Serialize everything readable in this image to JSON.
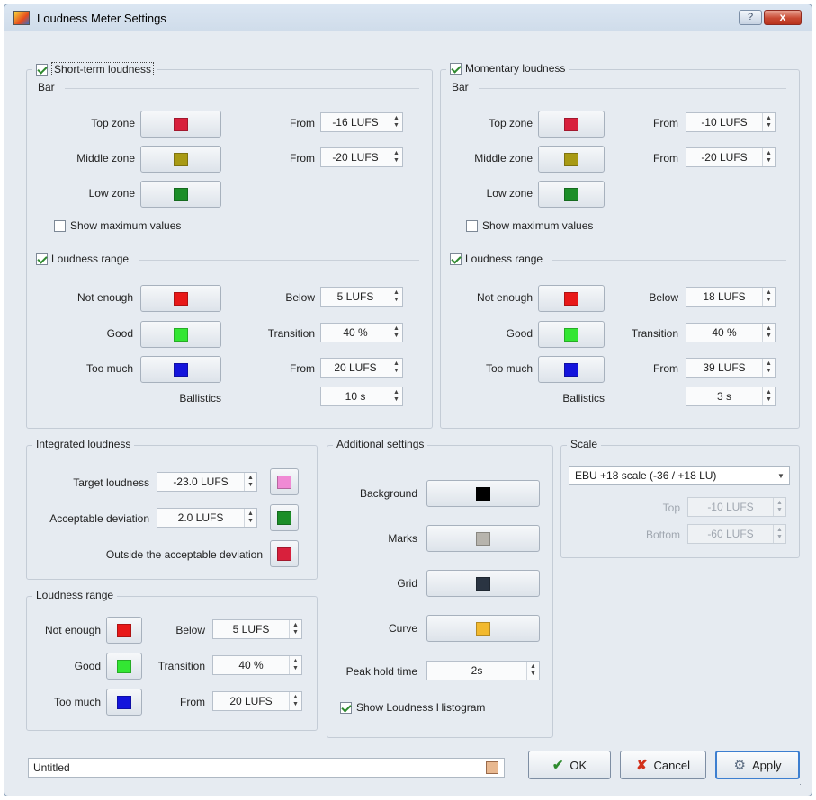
{
  "window": {
    "title": "Loudness Meter Settings",
    "help_label": "?",
    "close_label": "x"
  },
  "short_term": {
    "title": "Short-term loudness",
    "bar": {
      "label": "Bar",
      "top_zone": "Top zone",
      "middle_zone": "Middle zone",
      "low_zone": "Low zone",
      "from_label": "From",
      "top_from": "-16 LUFS",
      "middle_from": "-20 LUFS",
      "colors": {
        "top": "#d8203c",
        "middle": "#a89a14",
        "low": "#1c8e28"
      },
      "show_max": "Show maximum values"
    },
    "range": {
      "title": "Loudness range",
      "not_enough": "Not enough",
      "good": "Good",
      "too_much": "Too much",
      "below_label": "Below",
      "transition_label": "Transition",
      "from_label": "From",
      "below": "5 LUFS",
      "transition": "40 %",
      "from": "20 LUFS",
      "ballistics_label": "Ballistics",
      "ballistics": "10 s",
      "colors": {
        "not_enough": "#e81818",
        "good": "#33e633",
        "too_much": "#1414dc"
      }
    }
  },
  "momentary": {
    "title": "Momentary loudness",
    "bar": {
      "label": "Bar",
      "top_zone": "Top zone",
      "middle_zone": "Middle zone",
      "low_zone": "Low zone",
      "from_label": "From",
      "top_from": "-10 LUFS",
      "middle_from": "-20 LUFS",
      "colors": {
        "top": "#d8203c",
        "middle": "#a89a14",
        "low": "#1c8e28"
      },
      "show_max": "Show maximum values"
    },
    "range": {
      "title": "Loudness range",
      "not_enough": "Not enough",
      "good": "Good",
      "too_much": "Too much",
      "below_label": "Below",
      "transition_label": "Transition",
      "from_label": "From",
      "below": "18 LUFS",
      "transition": "40 %",
      "from": "39 LUFS",
      "ballistics_label": "Ballistics",
      "ballistics": "3 s",
      "colors": {
        "not_enough": "#e81818",
        "good": "#33e633",
        "too_much": "#1414dc"
      }
    }
  },
  "integrated": {
    "title": "Integrated loudness",
    "target_label": "Target loudness",
    "target": "-23.0 LUFS",
    "deviation_label": "Acceptable deviation",
    "deviation": "2.0 LUFS",
    "outside_label": "Outside the acceptable deviation",
    "colors": {
      "target": "#f08ad4",
      "deviation": "#1c8e28",
      "outside": "#d8203c"
    }
  },
  "loudness_range": {
    "title": "Loudness range",
    "not_enough": "Not enough",
    "good": "Good",
    "too_much": "Too much",
    "below_label": "Below",
    "transition_label": "Transition",
    "from_label": "From",
    "below": "5 LUFS",
    "transition": "40 %",
    "from": "20 LUFS",
    "colors": {
      "not_enough": "#e81818",
      "good": "#33e633",
      "too_much": "#1414dc"
    }
  },
  "additional": {
    "title": "Additional settings",
    "background_label": "Background",
    "marks_label": "Marks",
    "grid_label": "Grid",
    "curve_label": "Curve",
    "peak_label": "Peak hold time",
    "peak": "2s",
    "histogram_label": "Show Loudness Histogram",
    "colors": {
      "background": "#000000",
      "marks": "#b7b4ad",
      "grid": "#2a3442",
      "curve": "#f2b92e"
    }
  },
  "scale": {
    "title": "Scale",
    "selected": "EBU +18 scale (-36 / +18 LU)",
    "top_label": "Top",
    "top": "-10 LUFS",
    "bottom_label": "Bottom",
    "bottom": "-60 LUFS"
  },
  "footer": {
    "preset": "Untitled",
    "ok": "OK",
    "cancel": "Cancel",
    "apply": "Apply"
  }
}
